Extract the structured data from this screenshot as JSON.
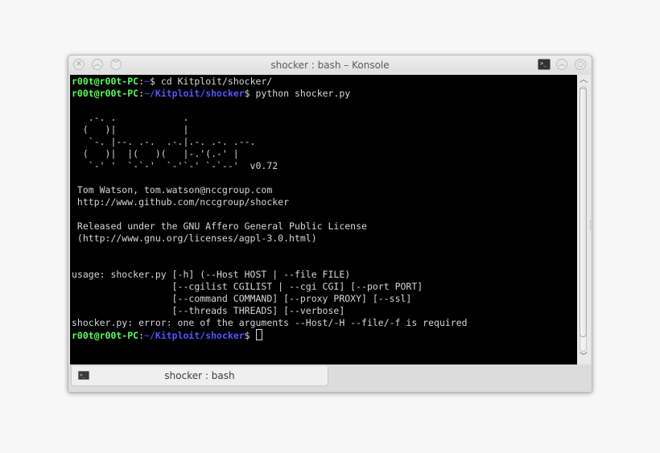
{
  "window": {
    "title": "shocker : bash – Konsole",
    "titlebar_buttons": [
      "close-icon",
      "minimize-icon",
      "maximize-icon"
    ],
    "right_buttons": [
      "konsole-menu-icon",
      "keep-above-icon",
      "maximize-icon"
    ]
  },
  "terminal": {
    "colors": {
      "background": "#000000",
      "foreground": "#d6d6d6",
      "user": "#54ff54",
      "path": "#5454ff"
    },
    "lines": [
      {
        "user": "r00t@r00t-PC",
        "sep": ":",
        "path": "~",
        "sym": "$",
        "cmd": " cd Kitploit/shocker/"
      },
      {
        "user": "r00t@r00t-PC",
        "sep": ":",
        "path_prefix": "~/",
        "path": "Kitploit/shocker",
        "sym": "$",
        "cmd": " python shocker.py"
      }
    ],
    "banner": [
      "",
      "   .-. .            .",
      "  (   )|            |",
      "   `-. |--. .-.  .-.|.-. .-. .--.",
      "  (   )|  |(   )(   |-.'(.-' |",
      "   `-' '  `-`-'  `-'`-' `-`--'  v0.72",
      "",
      " Tom Watson, tom.watson@nccgroup.com",
      " http://www.github.com/nccgroup/shocker",
      "",
      " Released under the GNU Affero General Public License",
      " (http://www.gnu.org/licenses/agpl-3.0.html)",
      "",
      "",
      "usage: shocker.py [-h] (--Host HOST | --file FILE)",
      "                  [--cgilist CGILIST | --cgi CGI] [--port PORT]",
      "                  [--command COMMAND] [--proxy PROXY] [--ssl]",
      "                  [--threads THREADS] [--verbose]",
      "shocker.py: error: one of the arguments --Host/-H --file/-f is required"
    ],
    "final_prompt": {
      "user": "r00t@r00t-PC",
      "sep": ":",
      "path_prefix": "~/",
      "path": "Kitploit/shocker",
      "sym": "$"
    }
  },
  "scrollbar": {
    "up_icon": "chevron-up-icon",
    "down_icon": "chevron-down-icon"
  },
  "tabs": [
    {
      "label": "shocker : bash",
      "icon": "terminal-icon"
    }
  ]
}
